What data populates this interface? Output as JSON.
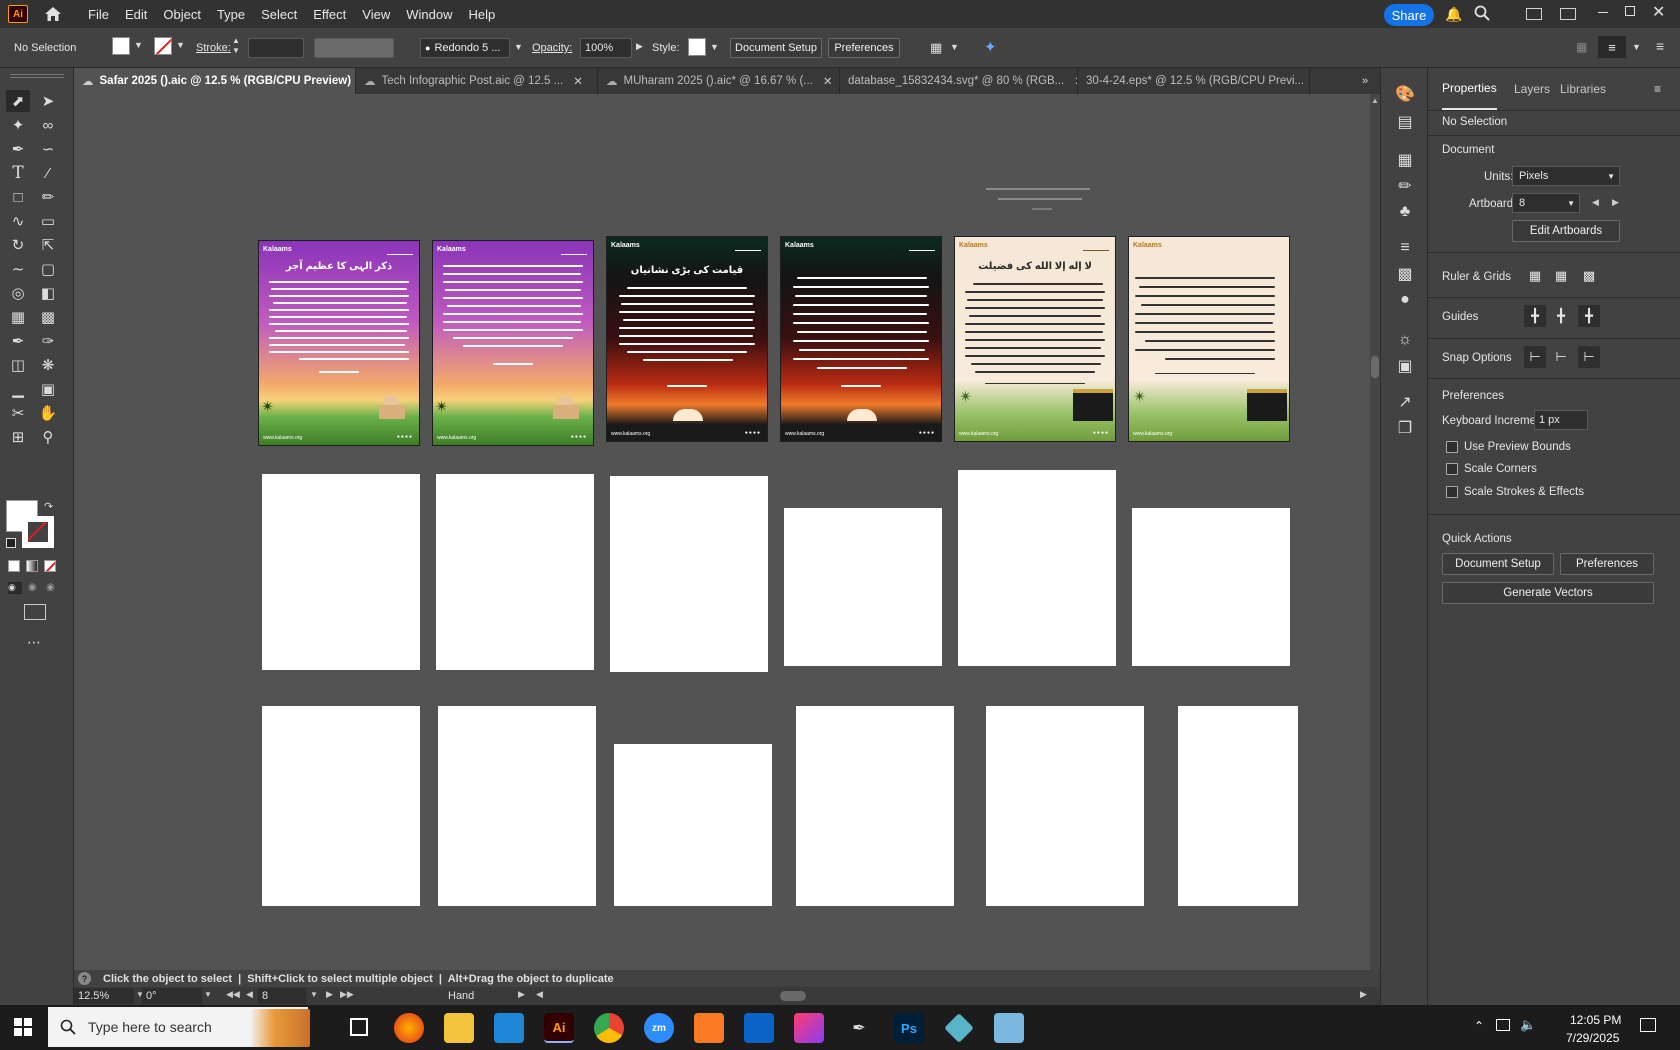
{
  "menubar": {
    "logo": "Ai",
    "items": [
      "File",
      "Edit",
      "Object",
      "Type",
      "Select",
      "Effect",
      "View",
      "Window",
      "Help"
    ],
    "share_label": "Share"
  },
  "control_bar": {
    "selection": "No Selection",
    "stroke_label": "Stroke:",
    "brush_value": "Redondo 5 ...",
    "opacity_label": "Opacity:",
    "opacity_value": "100%",
    "style_label": "Style:",
    "document_setup_label": "Document Setup",
    "preferences_label": "Preferences"
  },
  "tabs": [
    {
      "label": "Safar 2025 ().aic @ 12.5 % (RGB/CPU Preview)",
      "active": true
    },
    {
      "label": "Tech Infographic Post.aic @ 12.5 ...",
      "active": false
    },
    {
      "label": "MUharam 2025 ().aic* @ 16.67 % (...",
      "active": false
    },
    {
      "label": "database_15832434.svg* @ 80 % (RGB...",
      "active": false
    },
    {
      "label": "30-4-24.eps* @ 12.5 % (RGB/CPU Previ...",
      "active": false
    }
  ],
  "posters": [
    {
      "title": "ذکر الہی کا عظیم آجر",
      "brand": "Kalaams",
      "website": "www.kalaams.org",
      "theme": "purple"
    },
    {
      "title": "",
      "brand": "Kalaams",
      "website": "www.kalaams.org",
      "theme": "purple"
    },
    {
      "title": "قیامت کی بڑی نشانیاں",
      "brand": "Kalaams",
      "website": "www.kalaams.org",
      "theme": "dark-red"
    },
    {
      "title": "",
      "brand": "Kalaams",
      "website": "www.kalaams.org",
      "theme": "dark-red"
    },
    {
      "title": "لا إله إلا الله کی فضیلت",
      "brand": "Kalaams",
      "website": "www.kalaams.org",
      "theme": "cream"
    },
    {
      "title": "",
      "brand": "Kalaams",
      "website": "www.kalaams.org",
      "theme": "cream"
    }
  ],
  "status": {
    "hint": "Click the object to select  |  Shift+Click to select multiple object  |  Alt+Drag the object to duplicate",
    "zoom": "12.5%",
    "rotation": "0°",
    "artboard_number": "8",
    "tool": "Hand"
  },
  "panel": {
    "tabs": [
      "Properties",
      "Layers",
      "Libraries"
    ],
    "no_selection": "No Selection",
    "document_heading": "Document",
    "units_label": "Units:",
    "units_value": "Pixels",
    "artboard_label": "Artboard:",
    "artboard_value": "8",
    "edit_artboards_label": "Edit Artboards",
    "ruler_grids_label": "Ruler & Grids",
    "guides_label": "Guides",
    "snap_options_label": "Snap Options",
    "preferences_heading": "Preferences",
    "keyboard_increment_label": "Keyboard Increment:",
    "keyboard_increment_value": "1 px",
    "use_preview_bounds": "Use Preview Bounds",
    "scale_corners": "Scale Corners",
    "scale_strokes": "Scale Strokes & Effects",
    "quick_actions_heading": "Quick Actions",
    "document_setup_label": "Document Setup",
    "preferences_label": "Preferences",
    "generate_vectors_label": "Generate Vectors"
  },
  "taskbar": {
    "search_placeholder": "Type here to search",
    "time": "12:05 PM",
    "date": "7/29/2025",
    "apps": [
      "Zoom",
      "Ai",
      "Ps"
    ]
  },
  "colors": {
    "accent": "#1473e6",
    "ai_logo_bg": "#330000",
    "ai_logo_fg": "#ff9a00"
  }
}
